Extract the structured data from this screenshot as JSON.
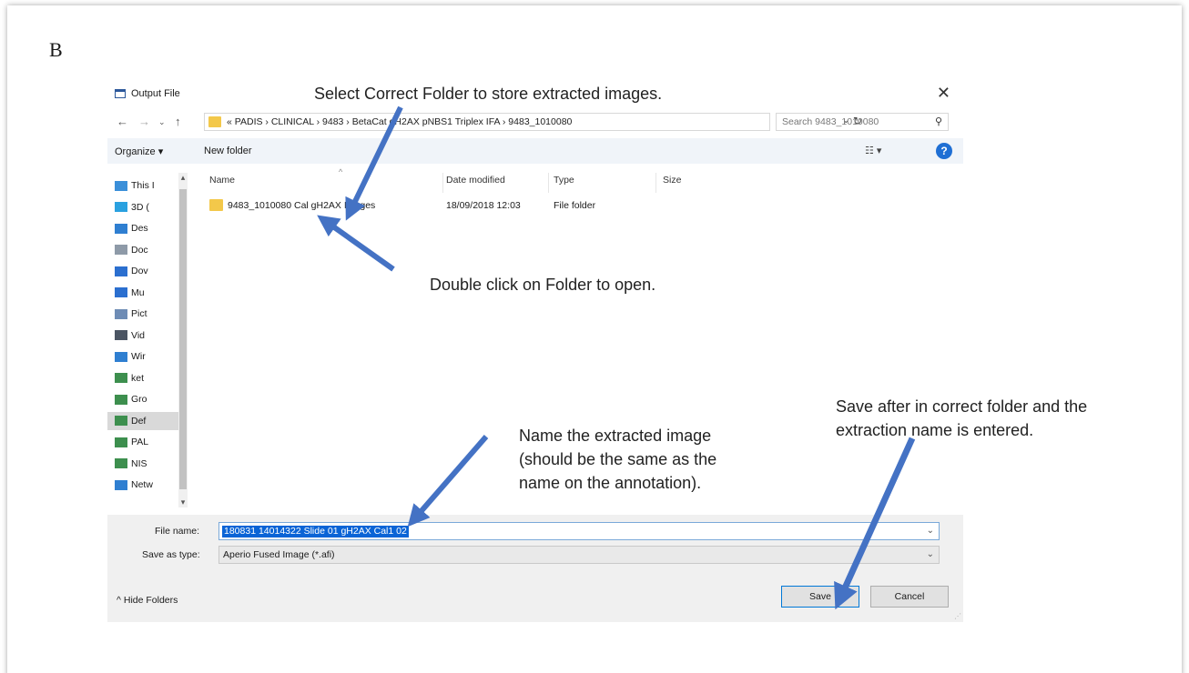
{
  "panel_letter": "B",
  "dialog": {
    "title": "Output File",
    "address_path": "« PADIS › CLINICAL › 9483 › BetaCat gH2AX pNBS1 Triplex IFA › 9483_1010080",
    "search_placeholder": "Search 9483_1010080",
    "toolbar": {
      "organize": "Organize ▾",
      "new_folder": "New folder",
      "view": "☷ ▾",
      "help": "?"
    },
    "nav_items": [
      {
        "label": "This I",
        "icon": "computer-icon",
        "color": "#3a8fd9"
      },
      {
        "label": "3D (",
        "icon": "cube-icon",
        "color": "#2aa1e0"
      },
      {
        "label": "Des",
        "icon": "desktop-icon",
        "color": "#2f7fd1"
      },
      {
        "label": "Doc",
        "icon": "document-icon",
        "color": "#8e9aa8"
      },
      {
        "label": "Dov",
        "icon": "download-icon",
        "color": "#2b6fcf"
      },
      {
        "label": "Mu",
        "icon": "music-icon",
        "color": "#2b6fcf"
      },
      {
        "label": "Pict",
        "icon": "picture-icon",
        "color": "#6e8cb5"
      },
      {
        "label": "Vid",
        "icon": "video-icon",
        "color": "#4b5563"
      },
      {
        "label": "Wir",
        "icon": "drive-icon",
        "color": "#2f7fd1"
      },
      {
        "label": "ket",
        "icon": "network-drive-icon",
        "color": "#3d8f4e"
      },
      {
        "label": "Gro",
        "icon": "network-drive-icon",
        "color": "#3d8f4e"
      },
      {
        "label": "Def",
        "icon": "network-drive-icon",
        "color": "#3d8f4e",
        "selected": true
      },
      {
        "label": "PAL",
        "icon": "network-drive-icon",
        "color": "#3d8f4e"
      },
      {
        "label": "NIS",
        "icon": "network-drive-icon",
        "color": "#3d8f4e"
      },
      {
        "label": "Netw",
        "icon": "network-icon",
        "color": "#2f7fd1"
      }
    ],
    "columns": {
      "name": "Name",
      "date": "Date modified",
      "type": "Type",
      "size": "Size"
    },
    "files": [
      {
        "name": "9483_1010080 Cal gH2AX Images",
        "date": "18/09/2018 12:03",
        "type": "File folder",
        "size": ""
      }
    ],
    "file_name_label": "File name:",
    "file_name_value": "180831 14014322 Slide 01 gH2AX Cal1 02",
    "save_type_label": "Save as type:",
    "save_type_value": "Aperio Fused Image (*.afi)",
    "hide_folders": "Hide Folders",
    "save_label": "Save",
    "cancel_label": "Cancel"
  },
  "annotations": {
    "select_folder": "Select Correct Folder to store extracted images.",
    "double_click": "Double click on Folder to open.",
    "name_image": [
      "Name the extracted image",
      "(should be the same as the",
      "name on the annotation)."
    ],
    "save_after": [
      "Save after in correct folder and the",
      "extraction name is entered."
    ],
    "arrow_color": "#4472c4"
  }
}
